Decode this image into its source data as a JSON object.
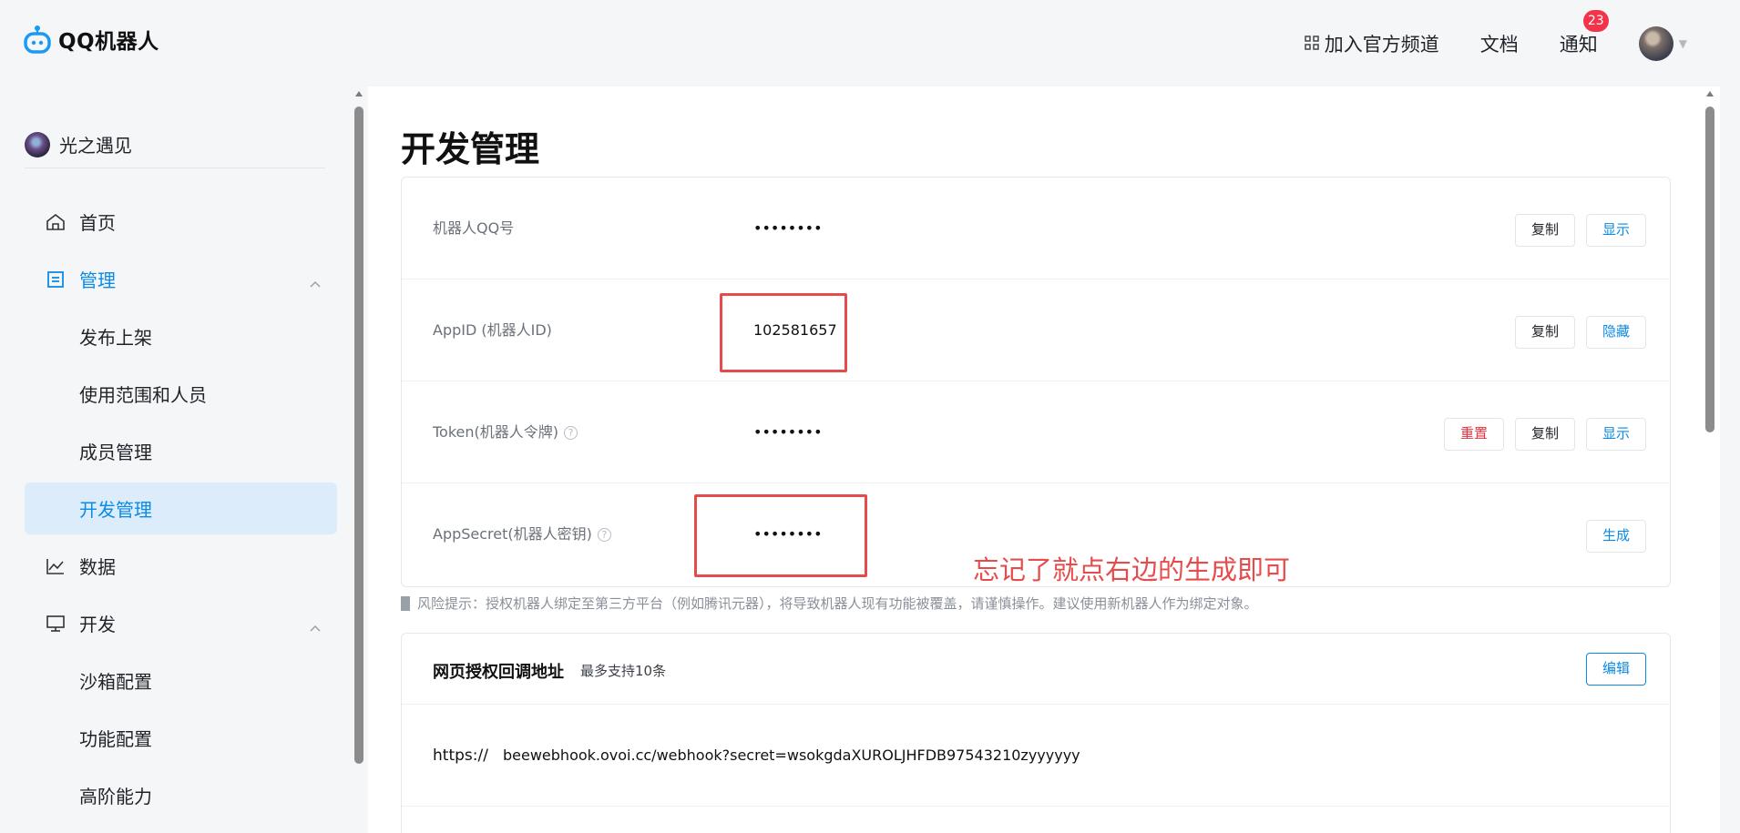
{
  "header": {
    "logo_text": "QQ机器人",
    "join_channel_label": "加入官方频道",
    "docs_label": "文档",
    "notify_label": "通知",
    "notify_count": "23"
  },
  "sidebar": {
    "user_name": "光之遇见",
    "items": [
      {
        "label": "首页",
        "icon": "home-icon"
      },
      {
        "label": "管理",
        "icon": "manage-icon"
      },
      {
        "label": "发布上架"
      },
      {
        "label": "使用范围和人员"
      },
      {
        "label": "成员管理"
      },
      {
        "label": "开发管理"
      },
      {
        "label": "数据",
        "icon": "chart-icon"
      },
      {
        "label": "开发",
        "icon": "monitor-icon"
      },
      {
        "label": "沙箱配置"
      },
      {
        "label": "功能配置"
      },
      {
        "label": "高阶能力"
      }
    ]
  },
  "main": {
    "title": "开发管理",
    "credentials": [
      {
        "label": "机器人QQ号",
        "value": "••••••••",
        "actions": [
          "复制",
          "显示"
        ]
      },
      {
        "label": "AppID (机器人ID)",
        "value": "102581657",
        "actions": [
          "复制",
          "隐藏"
        ]
      },
      {
        "label": "Token(机器人令牌)",
        "value": "••••••••",
        "actions": [
          "重置",
          "复制",
          "显示"
        ]
      },
      {
        "label": "AppSecret(机器人密钥)",
        "value": "••••••••",
        "actions": [
          "生成"
        ]
      }
    ],
    "annotation": "忘记了就点右边的生成即可",
    "risk_notice": "风险提示：授权机器人绑定至第三方平台（例如腾讯元器），将导致机器人现有功能被覆盖，请谨慎操作。建议使用新机器人作为绑定对象。",
    "callback": {
      "title": "网页授权回调地址",
      "subtitle": "最多支持10条",
      "edit_label": "编辑",
      "protocol": "https://",
      "url": "beewebhook.ovoi.cc/webhook?secret=wsokgdaXUROLJHFDB97543210zyyyyyy"
    }
  },
  "colors": {
    "accent": "#0b8be6",
    "danger": "#e8323f",
    "annotation": "#e54d4d",
    "selected_bg": "#dcecfb"
  }
}
